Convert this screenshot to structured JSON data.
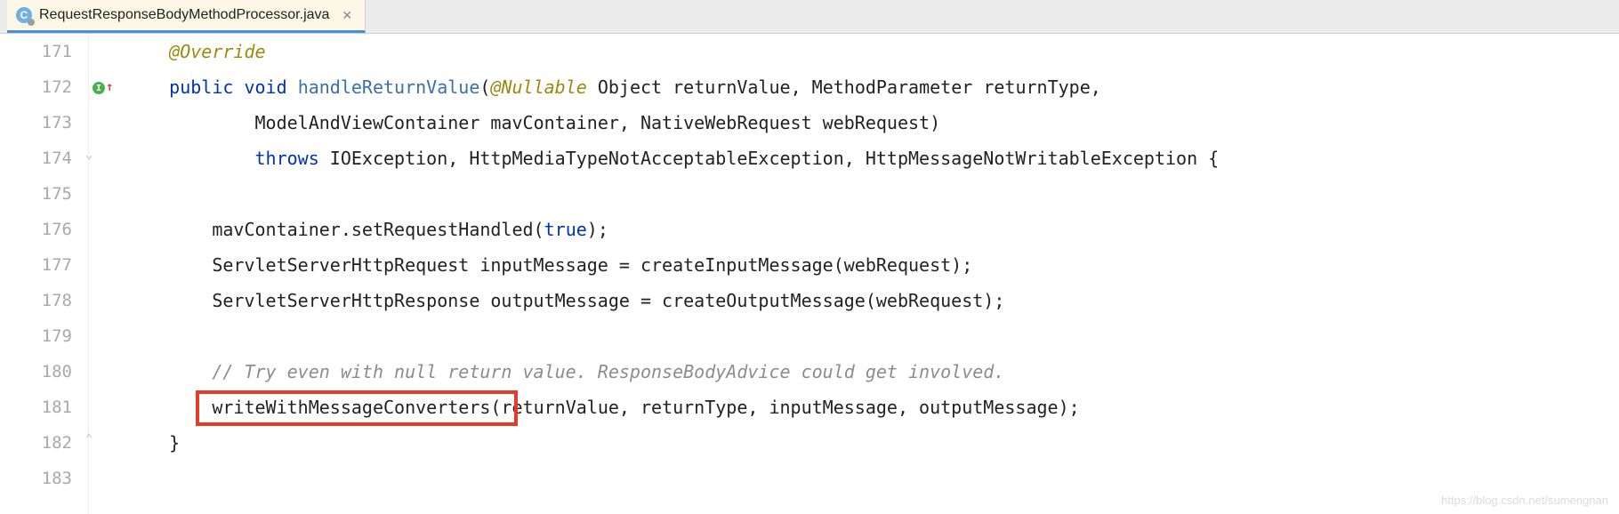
{
  "tab": {
    "filename": "RequestResponseBodyMethodProcessor.java",
    "icon_letter": "C"
  },
  "gutter_lines": [
    "171",
    "172",
    "173",
    "174",
    "175",
    "176",
    "177",
    "178",
    "179",
    "180",
    "181",
    "182",
    "183"
  ],
  "code": {
    "l171": {
      "indent": "    ",
      "annotation": "@Override"
    },
    "l172": {
      "indent": "    ",
      "kw1": "public",
      "kw2": "void",
      "method": "handleReturnValue",
      "open": "(",
      "ann": "@Nullable",
      "rest": " Object returnValue, MethodParameter returnType,"
    },
    "l173": {
      "indent": "            ",
      "text": "ModelAndViewContainer mavContainer, NativeWebRequest webRequest)"
    },
    "l174": {
      "indent": "            ",
      "kw": "throws",
      "rest": " IOException, HttpMediaTypeNotAcceptableException, HttpMessageNotWritableException {"
    },
    "l175": {
      "text": ""
    },
    "l176": {
      "indent": "        ",
      "part1": "mavContainer.setRequestHandled(",
      "bool": "true",
      "part2": ");"
    },
    "l177": {
      "indent": "        ",
      "text": "ServletServerHttpRequest inputMessage = createInputMessage(webRequest);"
    },
    "l178": {
      "indent": "        ",
      "text": "ServletServerHttpResponse outputMessage = createOutputMessage(webRequest);"
    },
    "l179": {
      "text": ""
    },
    "l180": {
      "indent": "        ",
      "comment": "// Try even with null return value. ResponseBodyAdvice could get involved."
    },
    "l181": {
      "indent": "        ",
      "highlight": "writeWithMessageConverters",
      "rest": "(returnValue, returnType, inputMessage, outputMessage);"
    },
    "l182": {
      "indent": "    ",
      "text": "}"
    }
  },
  "watermark": "https://blog.csdn.net/sumengnan"
}
